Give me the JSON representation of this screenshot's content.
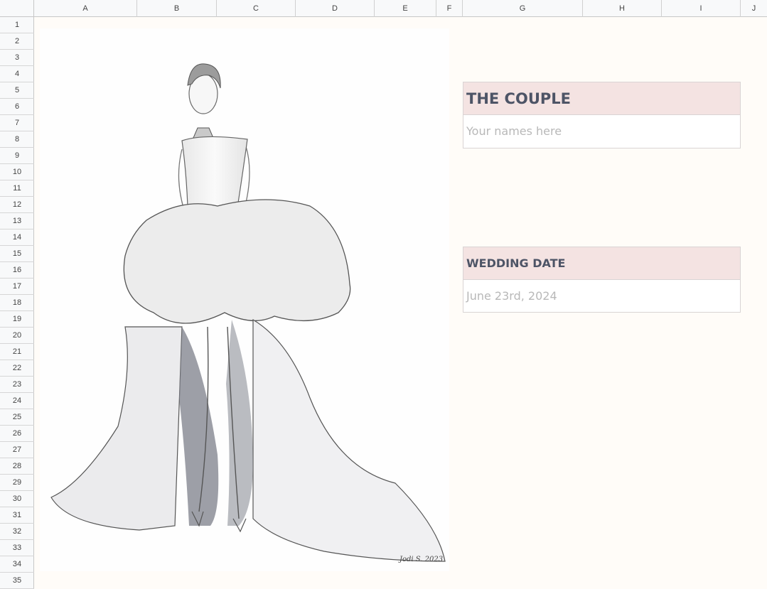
{
  "columns": [
    "A",
    "B",
    "C",
    "D",
    "E",
    "F",
    "G",
    "H",
    "I",
    "J"
  ],
  "rows": [
    "1",
    "2",
    "3",
    "4",
    "5",
    "6",
    "7",
    "8",
    "9",
    "10",
    "11",
    "12",
    "13",
    "14",
    "15",
    "16",
    "17",
    "18",
    "19",
    "20",
    "21",
    "22",
    "23",
    "24",
    "25",
    "26",
    "27",
    "28",
    "29",
    "30",
    "31",
    "32",
    "33",
    "34",
    "35"
  ],
  "couple": {
    "title": "THE COUPLE",
    "placeholder": "Your names here"
  },
  "wedding_date": {
    "title": "WEDDING DATE",
    "value": "June 23rd, 2024"
  },
  "artwork": {
    "description_icon": "dress-sketch-image",
    "signature": "Jodi S. 2023"
  }
}
